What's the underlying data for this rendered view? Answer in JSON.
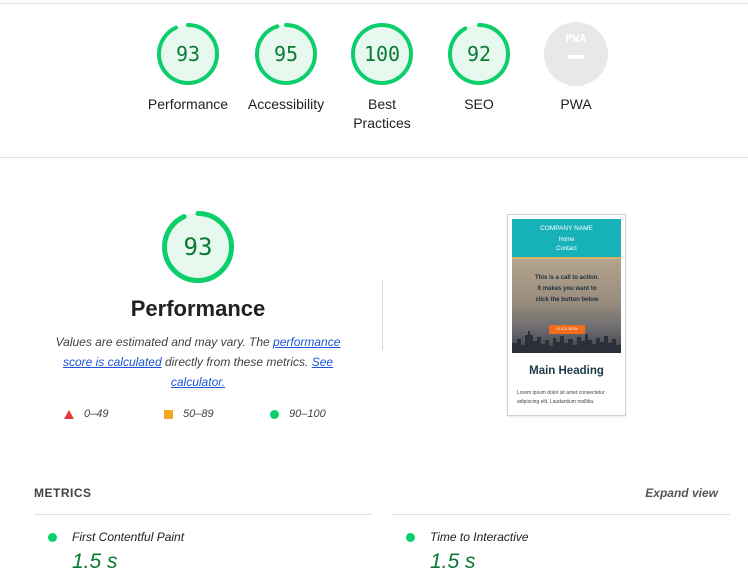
{
  "categories": [
    {
      "label": "Performance",
      "score": "93",
      "score_value": 93
    },
    {
      "label": "Accessibility",
      "score": "95",
      "score_value": 95
    },
    {
      "label": "Best Practices",
      "label_line1": "Best",
      "label_line2": "Practices",
      "score": "100",
      "score_value": 100
    },
    {
      "label": "SEO",
      "score": "92",
      "score_value": 92
    },
    {
      "label": "PWA",
      "badge": "PWA",
      "score": "–"
    }
  ],
  "performance": {
    "score": "93",
    "score_value": 93,
    "title": "Performance",
    "desc_part1": "Values are estimated and may vary. The ",
    "link_score_calculated": "performance score is calculated",
    "desc_part2": " directly from these metrics. ",
    "link_calculator": "See calculator.",
    "legend": [
      {
        "range": "0–49",
        "shape": "triangle",
        "color": "#e53935"
      },
      {
        "range": "50–89",
        "shape": "square",
        "color": "#f5a623"
      },
      {
        "range": "90–100",
        "shape": "circle",
        "color": "#0cce6b"
      }
    ]
  },
  "screenshot": {
    "company": "COMPANY NAME",
    "nav_home": "Home",
    "nav_contact": "Contact",
    "cta_line1": "This is a call to action.",
    "cta_line2": "It makes you want to",
    "cta_line3": "click the button below",
    "button": "CLICK NOW",
    "heading": "Main Heading",
    "body_line1": "Lorem ipsum dolor sit amet consectetur",
    "body_line2": "adipiscing elit. Laudantium mollitia."
  },
  "metrics": {
    "title": "METRICS",
    "expand": "Expand view",
    "items": [
      {
        "label": "First Contentful Paint",
        "value": "1.5 s",
        "status_color": "#0cce6b"
      },
      {
        "label": "Time to Interactive",
        "value": "1.5 s",
        "status_color": "#0cce6b"
      }
    ]
  },
  "colors": {
    "pass_green": "#0cce6b",
    "pass_text": "#0a7a33",
    "gauge_fill": "#e7f8ee"
  }
}
